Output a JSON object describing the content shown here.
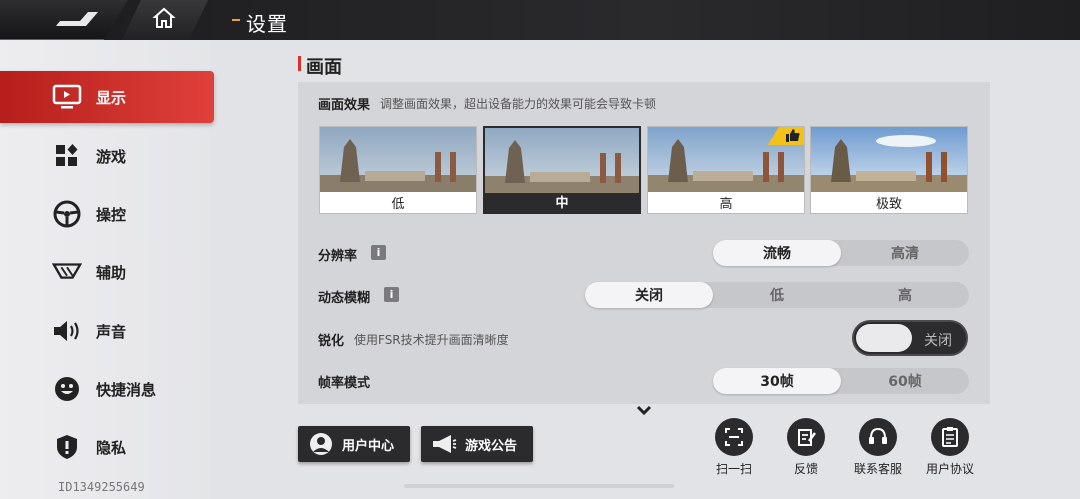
{
  "header": {
    "title": "设置"
  },
  "sidebar": {
    "items": [
      {
        "label": "显示",
        "icon": "monitor-icon",
        "active": true
      },
      {
        "label": "游戏",
        "icon": "grid-icon"
      },
      {
        "label": "操控",
        "icon": "steering-wheel-icon"
      },
      {
        "label": "辅助",
        "icon": "assist-icon"
      },
      {
        "label": "声音",
        "icon": "speaker-icon"
      },
      {
        "label": "快捷消息",
        "icon": "smiley-icon"
      },
      {
        "label": "隐私",
        "icon": "shield-icon"
      }
    ],
    "player_id": "ID1349255649"
  },
  "main": {
    "section_title": "画面",
    "quality": {
      "label": "画面效果",
      "hint": "调整画面效果，超出设备能力的效果可能会导致卡顿",
      "options": [
        "低",
        "中",
        "高",
        "极致"
      ],
      "selected": "中",
      "recommended": "高"
    },
    "resolution": {
      "label": "分辨率",
      "options": [
        "流畅",
        "高清"
      ],
      "selected": "流畅"
    },
    "motion_blur": {
      "label": "动态模糊",
      "options": [
        "关闭",
        "低",
        "高"
      ],
      "selected": "关闭"
    },
    "sharpen": {
      "label": "锐化",
      "hint": "使用FSR技术提升画面清晰度",
      "toggle_label": "关闭"
    },
    "frame_rate": {
      "label": "帧率模式",
      "options": [
        "30帧",
        "60帧"
      ],
      "selected": "30帧"
    }
  },
  "footer": {
    "user_center": "用户中心",
    "announcements": "游戏公告",
    "scan": "扫一扫",
    "feedback": "反馈",
    "support": "联系客服",
    "agreement": "用户协议"
  },
  "colors": {
    "accent": "#d8322d",
    "dark": "#2b2b2e",
    "badge": "#f3c21a"
  }
}
